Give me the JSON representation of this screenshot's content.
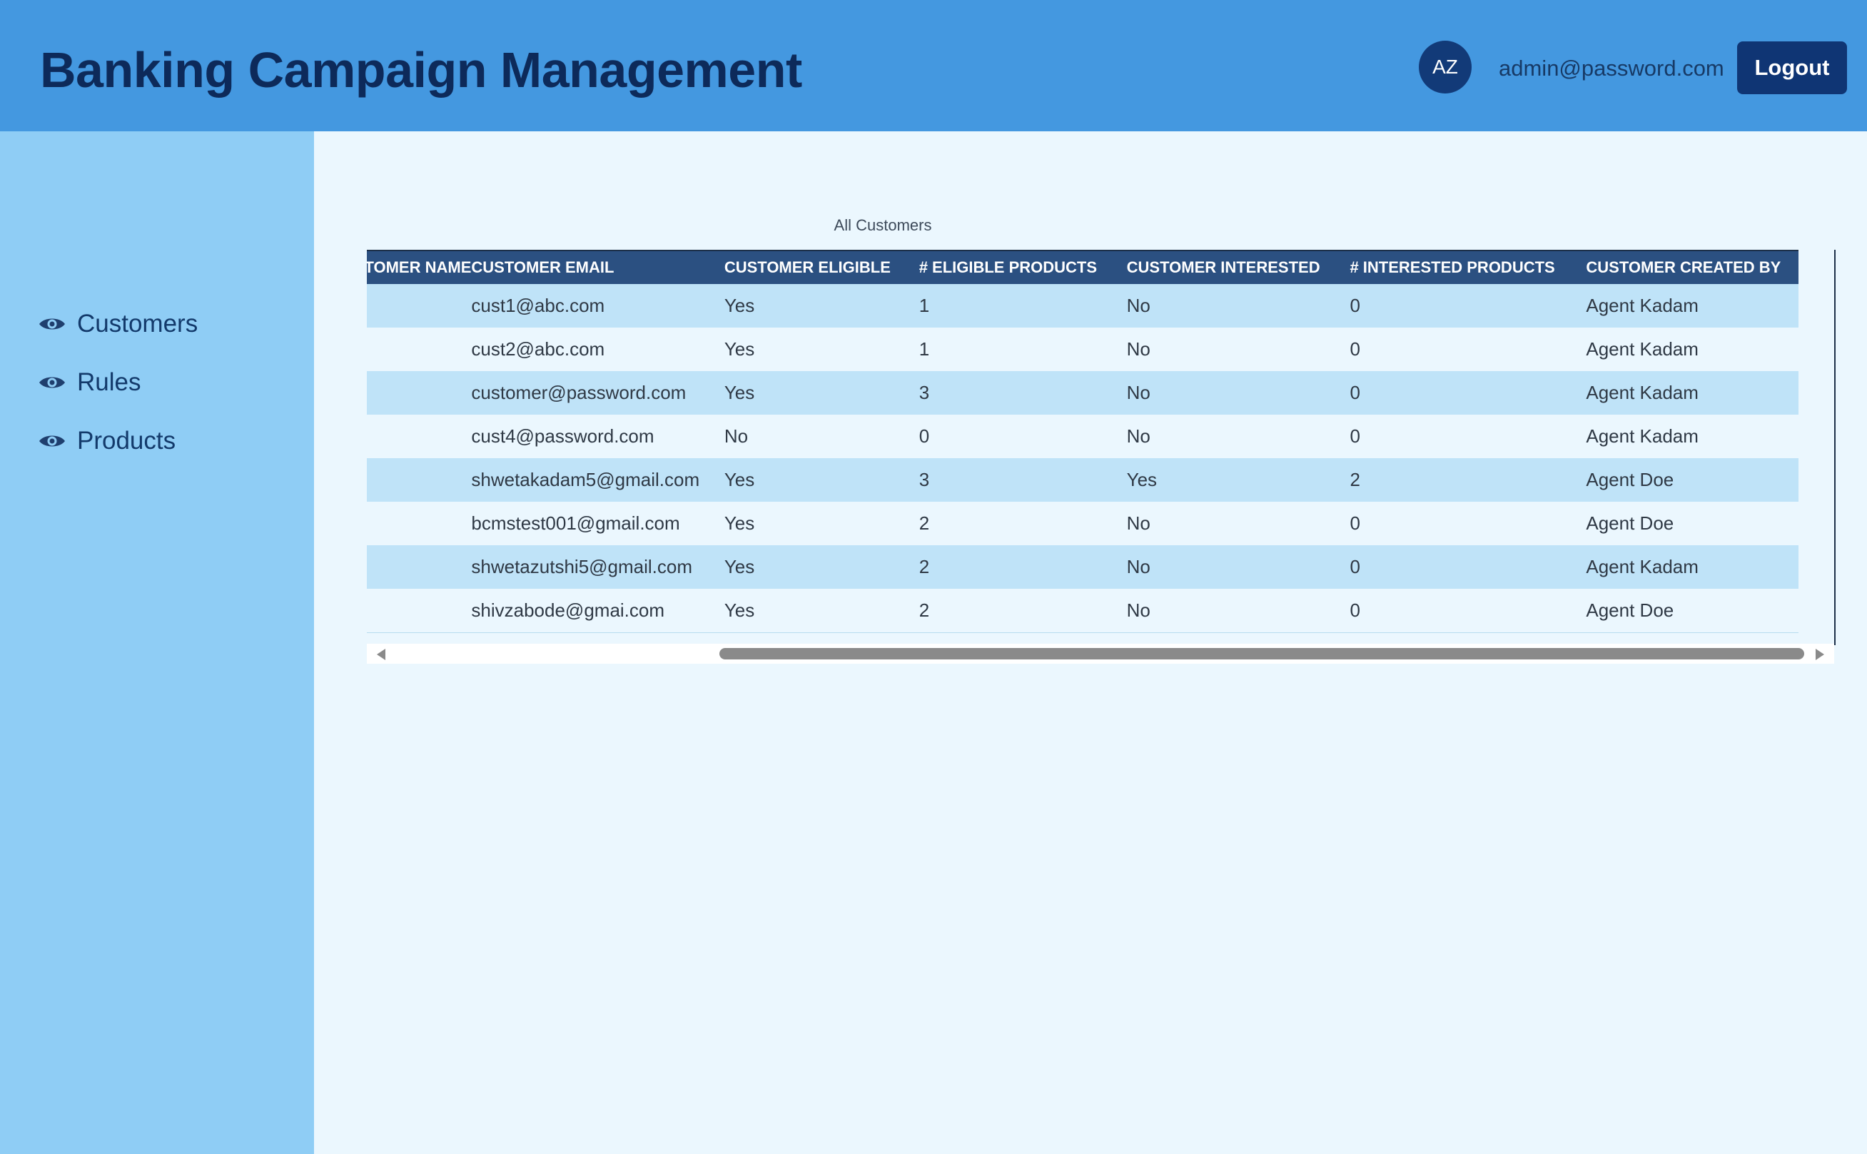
{
  "header": {
    "title": "Banking Campaign Management",
    "avatar_initials": "AZ",
    "user_email": "admin@password.com",
    "logout_label": "Logout"
  },
  "sidebar": {
    "items": [
      {
        "label": "Customers",
        "icon": "eye-icon"
      },
      {
        "label": "Rules",
        "icon": "eye-icon"
      },
      {
        "label": "Products",
        "icon": "eye-icon"
      }
    ]
  },
  "table": {
    "caption": "All Customers",
    "columns": [
      "CUSTOMER NAME",
      "CUSTOMER EMAIL",
      "CUSTOMER ELIGIBLE",
      "# ELIGIBLE PRODUCTS",
      "CUSTOMER INTERESTED",
      "# INTERESTED PRODUCTS",
      "CUSTOMER CREATED BY"
    ],
    "rows": [
      [
        "",
        "cust1@abc.com",
        "Yes",
        "1",
        "No",
        "0",
        "Agent Kadam"
      ],
      [
        "",
        "cust2@abc.com",
        "Yes",
        "1",
        "No",
        "0",
        "Agent Kadam"
      ],
      [
        "",
        "customer@password.com",
        "Yes",
        "3",
        "No",
        "0",
        "Agent Kadam"
      ],
      [
        "",
        "cust4@password.com",
        "No",
        "0",
        "No",
        "0",
        "Agent Kadam"
      ],
      [
        "",
        "shwetakadam5@gmail.com",
        "Yes",
        "3",
        "Yes",
        "2",
        "Agent Doe"
      ],
      [
        "",
        "bcmstest001@gmail.com",
        "Yes",
        "2",
        "No",
        "0",
        "Agent Doe"
      ],
      [
        "",
        "shwetazutshi5@gmail.com",
        "Yes",
        "2",
        "No",
        "0",
        "Agent Kadam"
      ],
      [
        "",
        "shivzabode@gmai.com",
        "Yes",
        "2",
        "No",
        "0",
        "Agent Doe"
      ]
    ]
  },
  "colors": {
    "header_bg": "#4498e0",
    "sidebar_bg": "#8fcdf5",
    "content_bg": "#ebf7fe",
    "table_header_bg": "#2b5081",
    "row_alt_bg": "#bfe3f8",
    "primary_dark": "#0f3574"
  }
}
